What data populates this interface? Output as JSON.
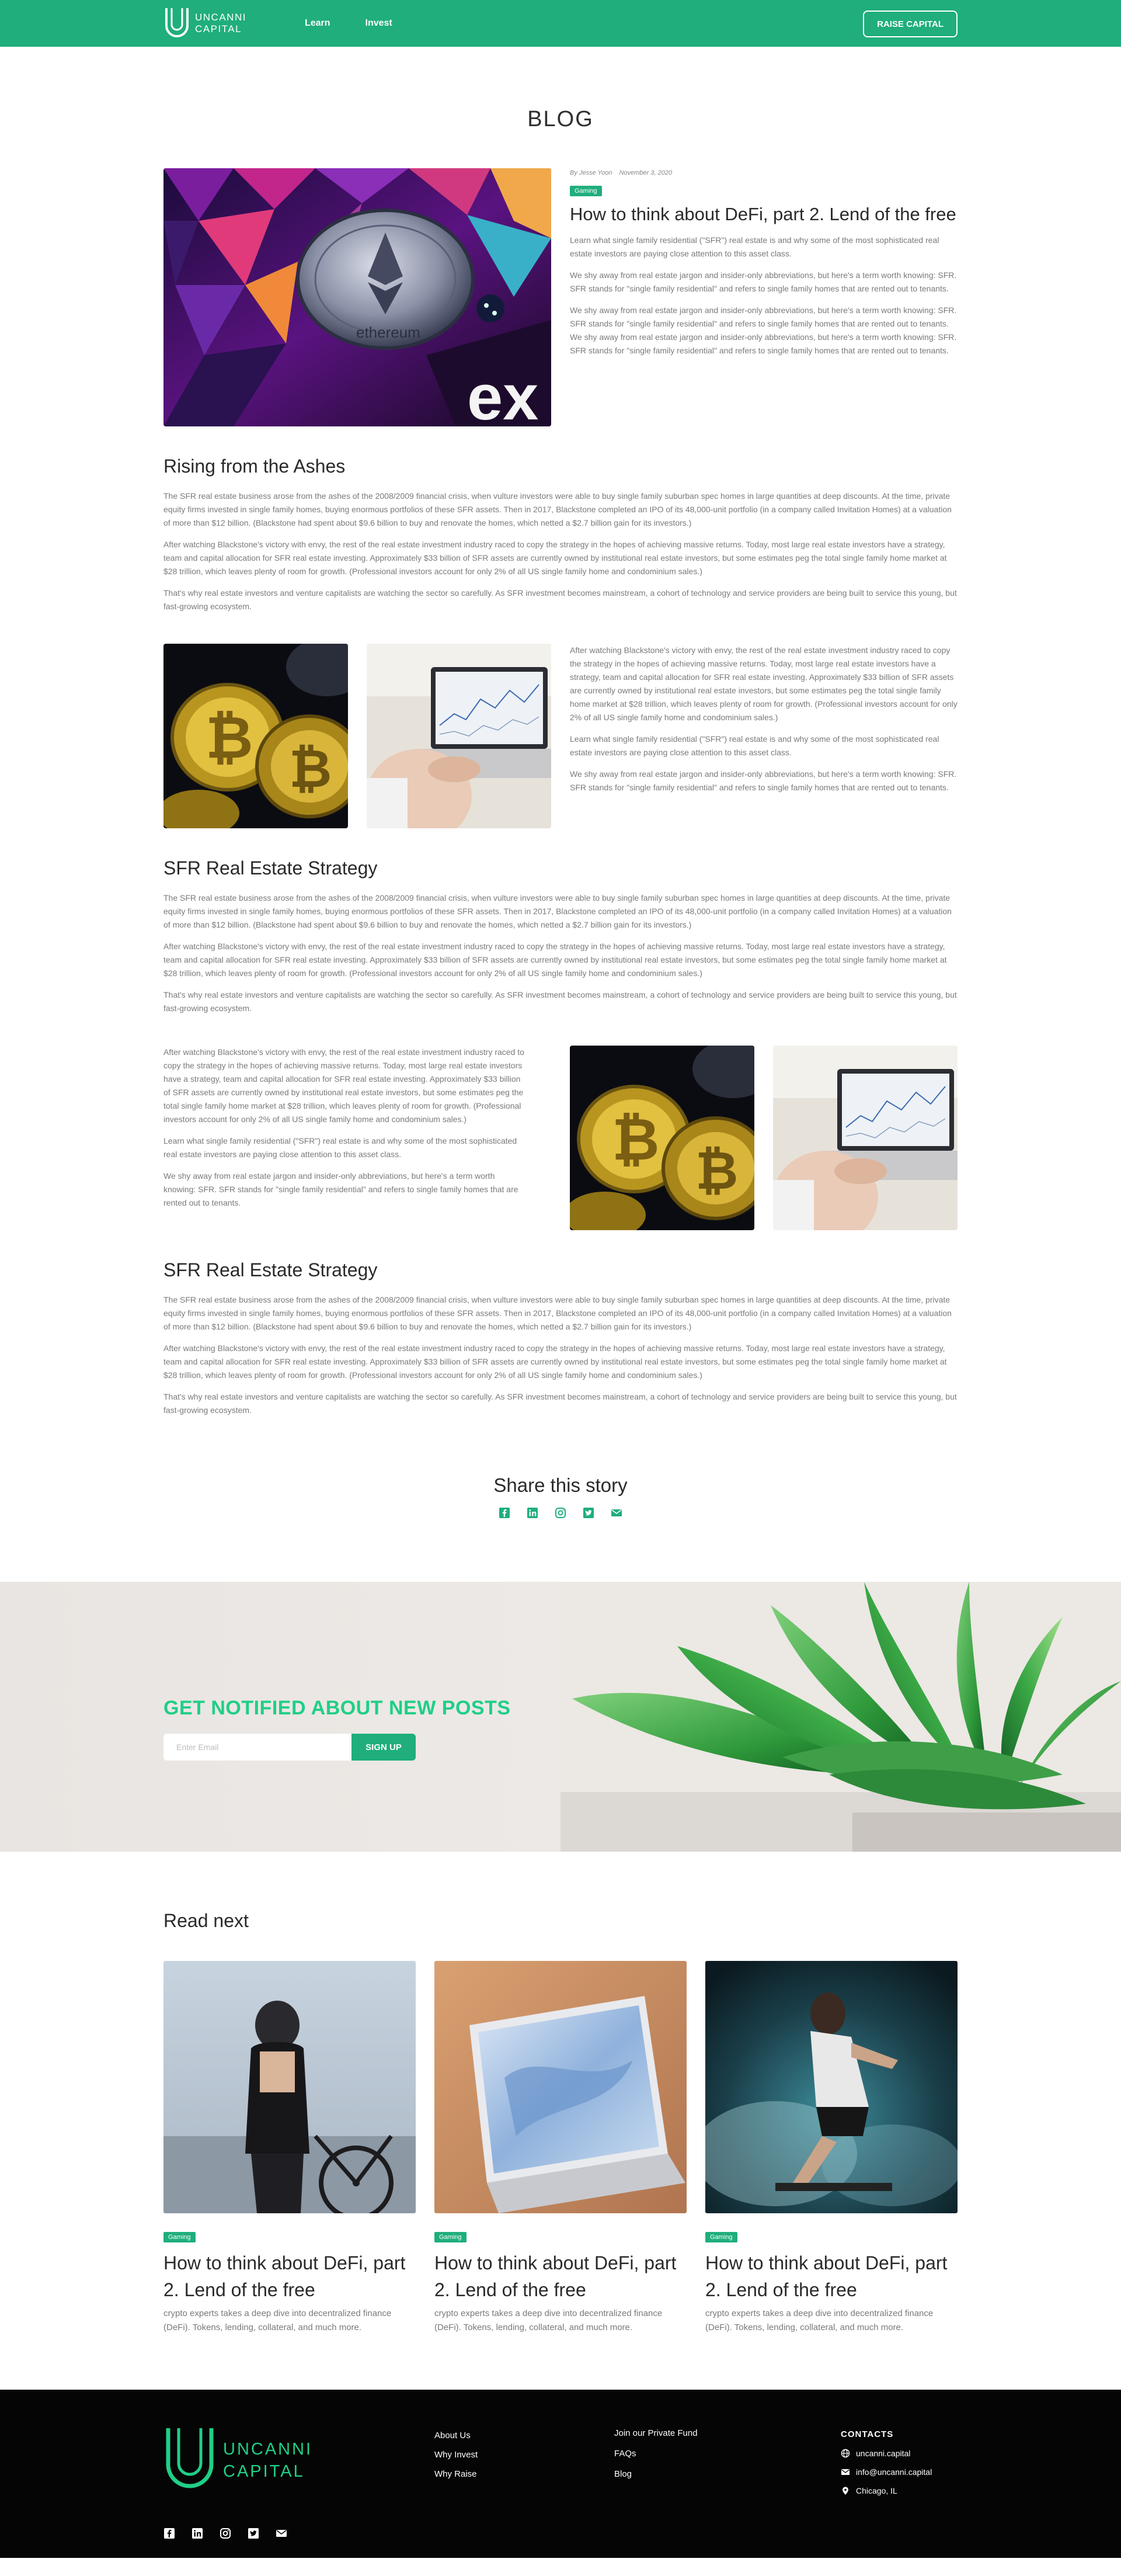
{
  "nav": {
    "logo_line1": "UNCANNI",
    "logo_line2": "CAPITAL",
    "links": [
      "Learn",
      "Invest"
    ],
    "cta": "RAISE CAPITAL"
  },
  "page": {
    "title": "BLOG"
  },
  "hero": {
    "author": "By Jesse Yoon",
    "date": "November 3, 2020",
    "tag": "Gaming",
    "title": "How to think about DeFi, part 2. Lend of the free",
    "paragraphs": [
      "Learn what single family residential (\"SFR\") real estate is and why some of the most sophisticated real estate investors are paying close attention to this asset class.",
      "We shy away from real estate jargon and insider-only abbreviations, but here's a term worth knowing: SFR. SFR stands for \"single family residential\" and refers to single family homes that are rented out to tenants.",
      "We shy away from real estate jargon and insider-only abbreviations, but here's a term worth knowing: SFR. SFR stands for \"single family residential\" and refers to single family homes that are rented out to tenants. We shy away from real estate jargon and insider-only abbreviations, but here's a term worth knowing: SFR. SFR stands for \"single family residential\" and refers to single family homes that are rented out to tenants."
    ]
  },
  "section1": {
    "title": "Rising from the Ashes",
    "paragraphs": [
      "The SFR real estate business arose from the ashes of the 2008/2009 financial crisis, when vulture investors were able to buy single family suburban spec homes in large quantities at deep discounts. At the time, private equity firms invested in single family homes, buying enormous portfolios of these SFR assets. Then in 2017, Blackstone completed an IPO of its 48,000-unit portfolio (in a company called Invitation Homes) at a valuation of more than $12 billion. (Blackstone had spent about $9.6 billion to buy and renovate the homes, which netted a $2.7 billion gain for its investors.)",
      "After watching Blackstone's victory with envy, the rest of the real estate investment industry raced to copy the strategy in the hopes of achieving massive returns. Today, most large real estate investors have a strategy, team and capital allocation for SFR real estate investing. Approximately $33 billion of SFR assets are currently owned by institutional real estate investors, but some estimates peg the total single family home market at $28 trillion, which leaves plenty of room for growth. (Professional investors account for only 2% of all US single family home and condominium sales.)",
      "That's why real estate investors and venture capitalists are watching the sector so carefully. As SFR investment becomes mainstream, a cohort of technology and service providers are being built to service this young, but fast-growing ecosystem."
    ]
  },
  "media1": {
    "paragraphs": [
      "After watching Blackstone's victory with envy, the rest of the real estate investment industry raced to copy the strategy in the hopes of achieving massive returns. Today, most large real estate investors have a strategy, team and capital allocation for SFR real estate investing. Approximately $33 billion of SFR assets are currently owned by institutional real estate investors, but some estimates peg the total single family home market at $28 trillion, which leaves plenty of room for growth. (Professional investors account for only 2% of all US single family home and condominium sales.)",
      "Learn what single family residential (\"SFR\") real estate is and why some of the most sophisticated real estate investors are paying close attention to this asset class.",
      "We shy away from real estate jargon and insider-only abbreviations, but here's a term worth knowing: SFR. SFR stands for \"single family residential\" and refers to single family homes that are rented out to tenants."
    ]
  },
  "section2": {
    "title": "SFR Real Estate Strategy",
    "paragraphs": [
      "The SFR real estate business arose from the ashes of the 2008/2009 financial crisis, when vulture investors were able to buy single family suburban spec homes in large quantities at deep discounts. At the time, private equity firms invested in single family homes, buying enormous portfolios of these SFR assets. Then in 2017, Blackstone completed an IPO of its 48,000-unit portfolio (in a company called Invitation Homes) at a valuation of more than $12 billion. (Blackstone had spent about $9.6 billion to buy and renovate the homes, which netted a $2.7 billion gain for its investors.)",
      "After watching Blackstone's victory with envy, the rest of the real estate investment industry raced to copy the strategy in the hopes of achieving massive returns. Today, most large real estate investors have a strategy, team and capital allocation for SFR real estate investing. Approximately $33 billion of SFR assets are currently owned by institutional real estate investors, but some estimates peg the total single family home market at $28 trillion, which leaves plenty of room for growth. (Professional investors account for only 2% of all US single family home and condominium sales.)",
      "That's why real estate investors and venture capitalists are watching the sector so carefully. As SFR investment becomes mainstream, a cohort of technology and service providers are being built to service this young, but fast-growing ecosystem."
    ]
  },
  "media2": {
    "paragraphs": [
      "After watching Blackstone's victory with envy, the rest of the real estate investment industry raced to copy the strategy in the hopes of achieving massive returns. Today, most large real estate investors have a strategy, team and capital allocation for SFR real estate investing. Approximately $33 billion of SFR assets are currently owned by institutional real estate investors, but some estimates peg the total single family home market at $28 trillion, which leaves plenty of room for growth. (Professional investors account for only 2% of all US single family home and condominium sales.)",
      "Learn what single family residential (\"SFR\") real estate is and why some of the most sophisticated real estate investors are paying close attention to this asset class.",
      "We shy away from real estate jargon and insider-only abbreviations, but here's a term worth knowing: SFR. SFR stands for \"single family residential\" and refers to single family homes that are rented out to tenants."
    ]
  },
  "section3": {
    "title": "SFR Real Estate Strategy",
    "paragraphs": [
      "The SFR real estate business arose from the ashes of the 2008/2009 financial crisis, when vulture investors were able to buy single family suburban spec homes in large quantities at deep discounts. At the time, private equity firms invested in single family homes, buying enormous portfolios of these SFR assets. Then in 2017, Blackstone completed an IPO of its 48,000-unit portfolio (in a company called Invitation Homes) at a valuation of more than $12 billion. (Blackstone had spent about $9.6 billion to buy and renovate the homes, which netted a $2.7 billion gain for its investors.)",
      "After watching Blackstone's victory with envy, the rest of the real estate investment industry raced to copy the strategy in the hopes of achieving massive returns. Today, most large real estate investors have a strategy, team and capital allocation for SFR real estate investing. Approximately $33 billion of SFR assets are currently owned by institutional real estate investors, but some estimates peg the total single family home market at $28 trillion, which leaves plenty of room for growth. (Professional investors account for only 2% of all US single family home and condominium sales.)",
      "That's why real estate investors and venture capitalists are watching the sector so carefully. As SFR investment becomes mainstream, a cohort of technology and service providers are being built to service this young, but fast-growing ecosystem."
    ]
  },
  "share": {
    "title": "Share this story",
    "icons": [
      "facebook-icon",
      "linkedin-icon",
      "instagram-icon",
      "twitter-icon",
      "mail-icon"
    ]
  },
  "newsletter": {
    "title": "GET NOTIFIED ABOUT NEW POSTS",
    "placeholder": "Enter Email",
    "button": "SIGN UP"
  },
  "read_next": {
    "title": "Read next",
    "cards": [
      {
        "tag": "Gaming",
        "title": "How to think about DeFi, part 2. Lend of the free",
        "desc": "crypto experts takes a deep dive into decentralized finance (DeFi). Tokens, lending, collateral, and much more."
      },
      {
        "tag": "Gaming",
        "title": "How to think about DeFi, part 2. Lend of the free",
        "desc": "crypto experts takes a deep dive into decentralized finance (DeFi). Tokens, lending, collateral, and much more."
      },
      {
        "tag": "Gaming",
        "title": "How to think about DeFi, part 2. Lend of the free",
        "desc": "crypto experts takes a deep dive into decentralized finance (DeFi). Tokens, lending, collateral, and much more."
      }
    ]
  },
  "footer": {
    "logo_line1": "UNCANNI",
    "logo_line2": "CAPITAL",
    "col1": [
      "About Us",
      "Why Invest",
      "Why Raise"
    ],
    "col2": [
      "Join our Private Fund",
      "FAQs",
      "Blog"
    ],
    "contacts_title": "CONTACTS",
    "contacts": [
      "uncanni.capital",
      "info@uncanni.capital",
      "Chicago, IL"
    ]
  },
  "colors": {
    "brand": "#1fae7c",
    "accent": "#1fcf86",
    "footer_bg": "#050505"
  }
}
